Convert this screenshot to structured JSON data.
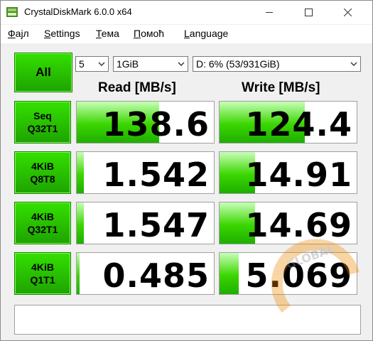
{
  "window": {
    "title": "CrystalDiskMark 6.0.0 x64"
  },
  "menu": {
    "items": [
      {
        "underline": "Ф",
        "rest": "ајл"
      },
      {
        "underline": "S",
        "rest": "ettings"
      },
      {
        "underline": "Т",
        "rest": "ема"
      },
      {
        "underline": "П",
        "rest": "омоћ"
      },
      {
        "underline": "L",
        "rest": "anguage"
      }
    ]
  },
  "controls": {
    "all_label": "All",
    "count": "5",
    "size": "1GiB",
    "drive": "D: 6% (53/931GiB)"
  },
  "headers": {
    "read": "Read [MB/s]",
    "write": "Write [MB/s]"
  },
  "tests": [
    {
      "line1": "Seq",
      "line2": "Q32T1",
      "read": "138.6",
      "write": "124.4",
      "read_fill": 0.6,
      "write_fill": 0.62
    },
    {
      "line1": "4KiB",
      "line2": "Q8T8",
      "read": "1.542",
      "write": "14.91",
      "read_fill": 0.05,
      "write_fill": 0.26
    },
    {
      "line1": "4KiB",
      "line2": "Q32T1",
      "read": "1.547",
      "write": "14.69",
      "read_fill": 0.05,
      "write_fill": 0.26
    },
    {
      "line1": "4KiB",
      "line2": "Q1T1",
      "read": "0.485",
      "write": "5.069",
      "read_fill": 0.02,
      "write_fill": 0.14
    }
  ],
  "comment": "",
  "colors": {
    "accent_green": "#1ea300",
    "bar_green": "#3bd600"
  },
  "watermark": {
    "text": "GLOBAL"
  }
}
